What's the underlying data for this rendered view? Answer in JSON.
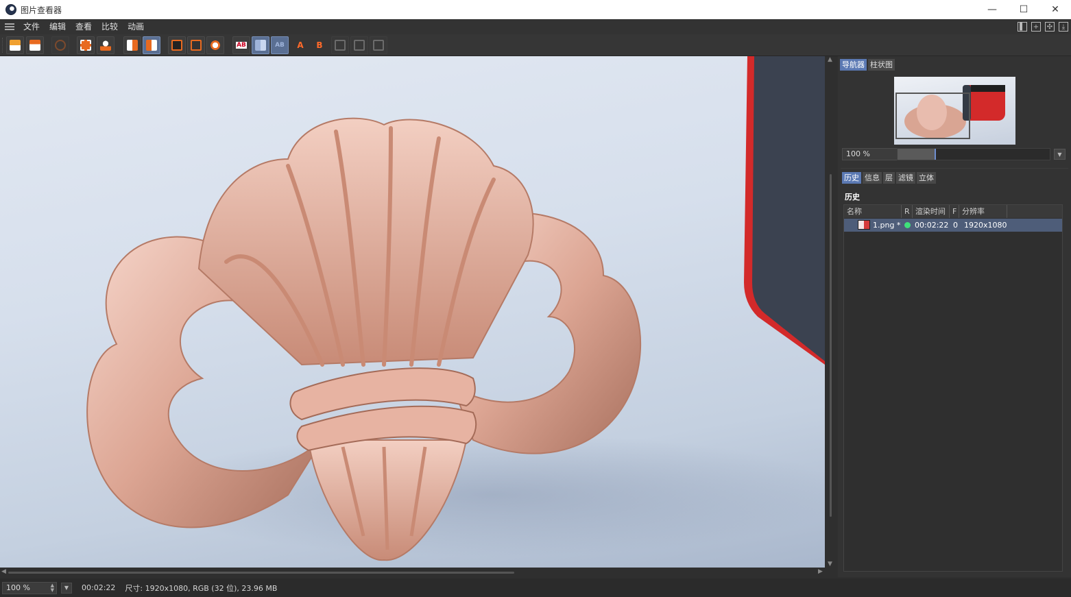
{
  "window": {
    "title": "图片查看器",
    "controls": {
      "minimize": "—",
      "maximize": "☐",
      "close": "✕"
    }
  },
  "menu": [
    "文件",
    "编辑",
    "查看",
    "比较",
    "动画"
  ],
  "toolbar_icons": [
    "open-file-icon",
    "save-file-icon",
    "stop-icon",
    "crop-icon",
    "stamp-icon",
    "copy-left-icon",
    "copy-right-icon",
    "view-single-icon",
    "view-a-icon",
    "view-b-icon",
    "ab-icon",
    "split-icon",
    "ab-overlay-icon",
    "set-a-icon",
    "set-b-icon",
    "compare-1-icon",
    "compare-2-icon",
    "compare-3-icon"
  ],
  "toolbar_labels": {
    "set_a": "A",
    "set_b": "B",
    "ab": "AB"
  },
  "navigator": {
    "tabs": [
      "导航器",
      "柱状图"
    ],
    "zoom": "100 %",
    "zoom_fraction": 0.25
  },
  "history_panel": {
    "tabs": [
      "历史",
      "信息",
      "层",
      "滤镜",
      "立体"
    ],
    "title": "历史",
    "columns": [
      "名称",
      "R",
      "渲染时间",
      "F",
      "分辨率"
    ],
    "rows": [
      {
        "name": "1.png *",
        "render_time": "00:02:22",
        "frame": "0",
        "resolution": "1920x1080",
        "status_color": "#3fe07a"
      }
    ]
  },
  "statusbar": {
    "zoom": "100 %",
    "time": "00:02:22",
    "info": "尺寸: 1920x1080, RGB (32 位), 23.96 MB"
  },
  "colors": {
    "accent": "#5b79b3",
    "selection": "#4e5d79",
    "copper": "#d9a593",
    "red_object": "#d32a2a"
  }
}
